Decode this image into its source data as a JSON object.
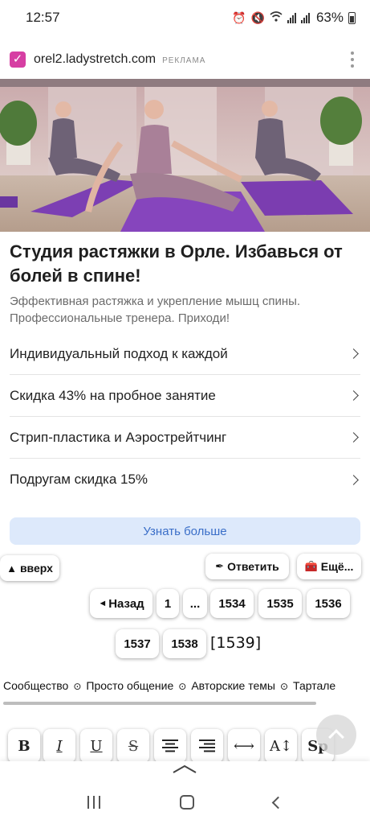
{
  "status_bar": {
    "time": "12:57",
    "battery": "63%"
  },
  "ad": {
    "domain": "orel2.ladystretch.com",
    "label": "РЕКЛАМА",
    "title": "Студия растяжки в Орле. Избавься от болей в спине!",
    "description": "Эффективная растяжка и укрепление мышц спины. Профессиональные тренера. Приходи!",
    "links": [
      "Индивидуальный подход к каждой",
      "Скидка 43% на пробное занятие",
      "Стрип-пластика и Аэрострейтчинг",
      "Подругам скидка 15%"
    ],
    "cta": "Узнать больше"
  },
  "forum": {
    "up_label": "вверх",
    "reply_label": "Ответить",
    "more_label": "Ещё...",
    "pager": {
      "back": "Назад",
      "pages_row1": [
        "1",
        "...",
        "1534",
        "1535",
        "1536"
      ],
      "pages_row2": [
        "1537",
        "1538"
      ],
      "current": "[1539]"
    },
    "breadcrumbs": [
      "Сообщество",
      "Просто общение",
      "Авторские темы",
      "Тартале"
    ]
  },
  "toolbar": {
    "bold": "B",
    "italic": "I",
    "underline": "U",
    "strike": "S",
    "sp": "Sp"
  }
}
